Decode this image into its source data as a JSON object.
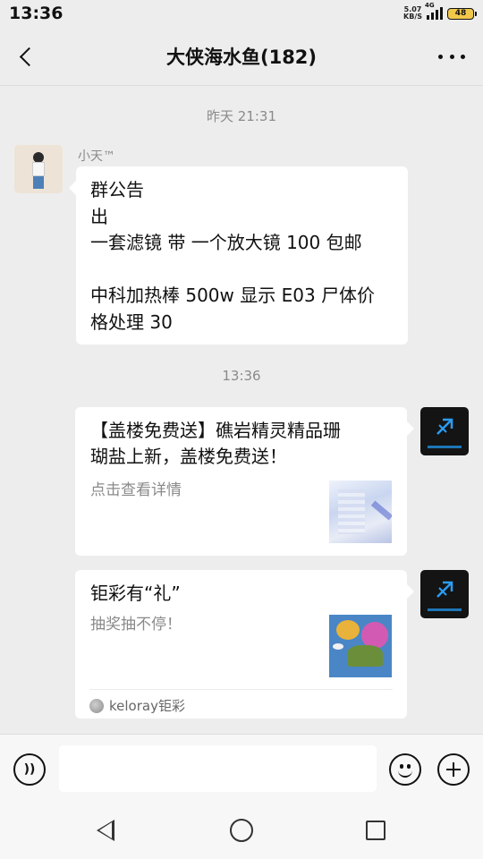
{
  "status_bar": {
    "time": "13:36",
    "net_speed_value": "5.07",
    "net_speed_unit": "KB/S",
    "network": "4G",
    "battery": "48"
  },
  "header": {
    "title": "大侠海水鱼(182)"
  },
  "messages": {
    "timestamp_1": "昨天 21:31",
    "sender_1": "小天™",
    "announcement_lines": [
      "群公告",
      "出",
      "一套滤镜 带 一个放大镜 100 包邮",
      "",
      "中科加热棒 500w 显示 E03 尸体价",
      "格处理 30"
    ],
    "timestamp_2": "13:36",
    "card_1": {
      "title_line1": "【盖楼免费送】礁岩精灵精品珊",
      "title_line2": "瑚盐上新，盖楼免费送！",
      "description": "点击查看详情"
    },
    "card_2": {
      "title": "钜彩有“礼”",
      "description": "抽奖抽不停！",
      "source": "keloray钜彩"
    }
  },
  "input_bar": {
    "voice_glyph": "))",
    "text_value": ""
  }
}
